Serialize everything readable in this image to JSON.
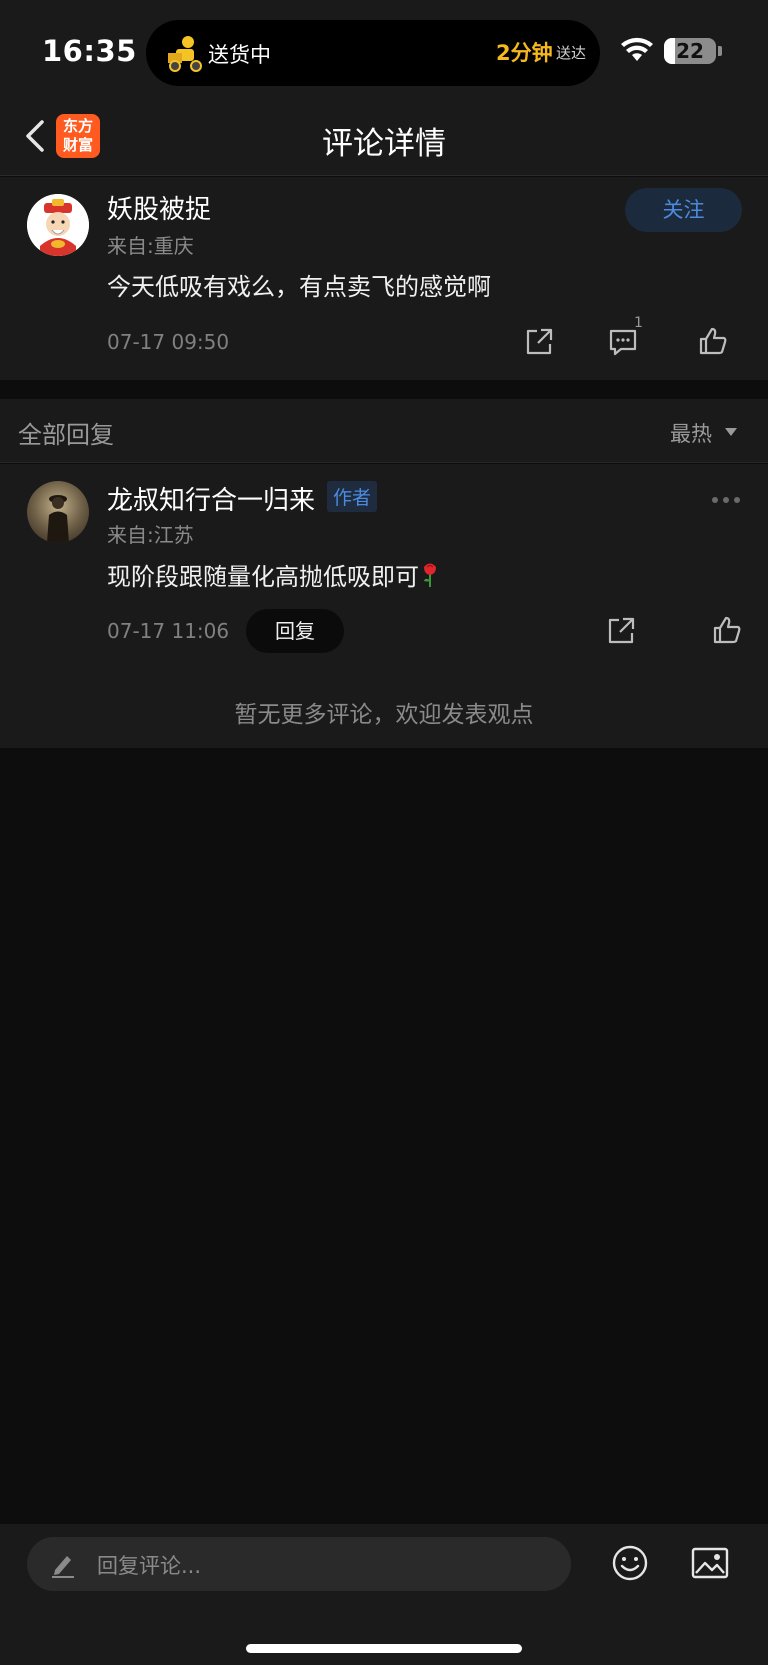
{
  "status_bar": {
    "time": "16:35",
    "delivery_status": "送货中",
    "eta": "2分钟",
    "eta_suffix": "送达",
    "battery": "22",
    "battery_level": 0.22
  },
  "nav": {
    "logo_line1": "东方",
    "logo_line2": "财富",
    "title": "评论详情"
  },
  "comment": {
    "username": "妖股被捉",
    "location": "来自:重庆",
    "follow_label": "关注",
    "content": "今天低吸有戏么，有点卖飞的感觉啊",
    "date": "07-17 09:50",
    "reply_count": "1"
  },
  "replies_section": {
    "title": "全部回复",
    "sort_label": "最热"
  },
  "reply": {
    "username": "龙叔知行合一归来",
    "badge": "作者",
    "location": "来自:江苏",
    "content": "现阶段跟随量化高抛低吸即可",
    "date": "07-17 11:06",
    "reply_label": "回复"
  },
  "no_more_text": "暂无更多评论，欢迎发表观点",
  "input": {
    "placeholder": "回复评论..."
  },
  "colors": {
    "background": "#0d0d0d",
    "panel": "#1a1a1a",
    "accent_blue": "#4b8bdf",
    "brand_orange": "#ff5a1f",
    "eta_yellow": "#f5b81f"
  },
  "icons": [
    "back-icon",
    "share-icon",
    "chat-icon",
    "like-icon",
    "more-icon",
    "pencil-icon",
    "emoji-icon",
    "image-icon",
    "wifi-icon",
    "rose-emoji"
  ]
}
